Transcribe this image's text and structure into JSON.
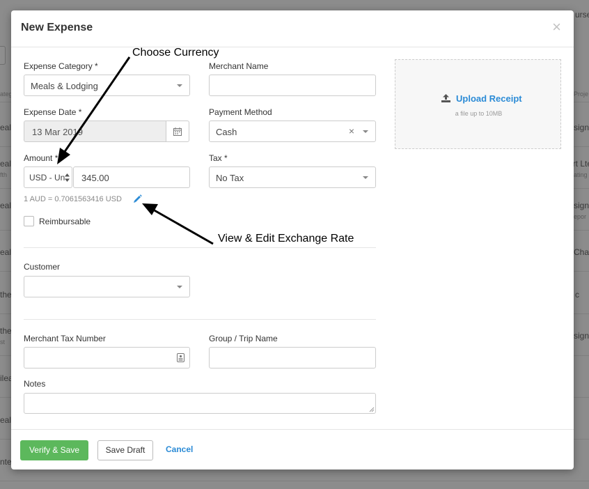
{
  "background": {
    "fragments": [
      "urse",
      "ateg",
      "Proje",
      "eal",
      "signm",
      "ealth",
      "ort Lte",
      "fth",
      "ating",
      "eal",
      "signm",
      "epor",
      "eal",
      "Char",
      "the",
      "c",
      "the",
      "st",
      "signm",
      "ilea",
      "eal",
      "nter"
    ]
  },
  "modal": {
    "title": "New Expense",
    "close_label": "×"
  },
  "form": {
    "expense_category": {
      "label": "Expense Category *",
      "value": "Meals & Lodging"
    },
    "merchant_name": {
      "label": "Merchant Name",
      "value": ""
    },
    "expense_date": {
      "label": "Expense Date *",
      "value": "13 Mar 2019"
    },
    "payment_method": {
      "label": "Payment Method",
      "value": "Cash",
      "clear": "×"
    },
    "amount": {
      "label": "Amount *",
      "currency": "USD - Un",
      "value": "345.00"
    },
    "tax": {
      "label": "Tax *",
      "value": "No Tax"
    },
    "exchange_rate": "1 AUD = 0.7061563416 USD",
    "reimbursable": {
      "label": "Reimbursable",
      "checked": false
    },
    "customer": {
      "label": "Customer",
      "value": ""
    },
    "merchant_tax_number": {
      "label": "Merchant Tax Number",
      "value": ""
    },
    "group_trip_name": {
      "label": "Group / Trip Name",
      "value": ""
    },
    "notes": {
      "label": "Notes",
      "value": ""
    }
  },
  "upload": {
    "label": "Upload Receipt",
    "hint": "a file up to 10MB"
  },
  "footer": {
    "verify_save": "Verify & Save",
    "save_draft": "Save Draft",
    "cancel": "Cancel"
  },
  "annotations": {
    "choose_currency": "Choose Currency",
    "view_edit_rate": "View & Edit Exchange Rate"
  },
  "colors": {
    "accent": "#2b8bd6",
    "primary_button": "#5cb85c",
    "overlay": "#8c8c8c"
  }
}
